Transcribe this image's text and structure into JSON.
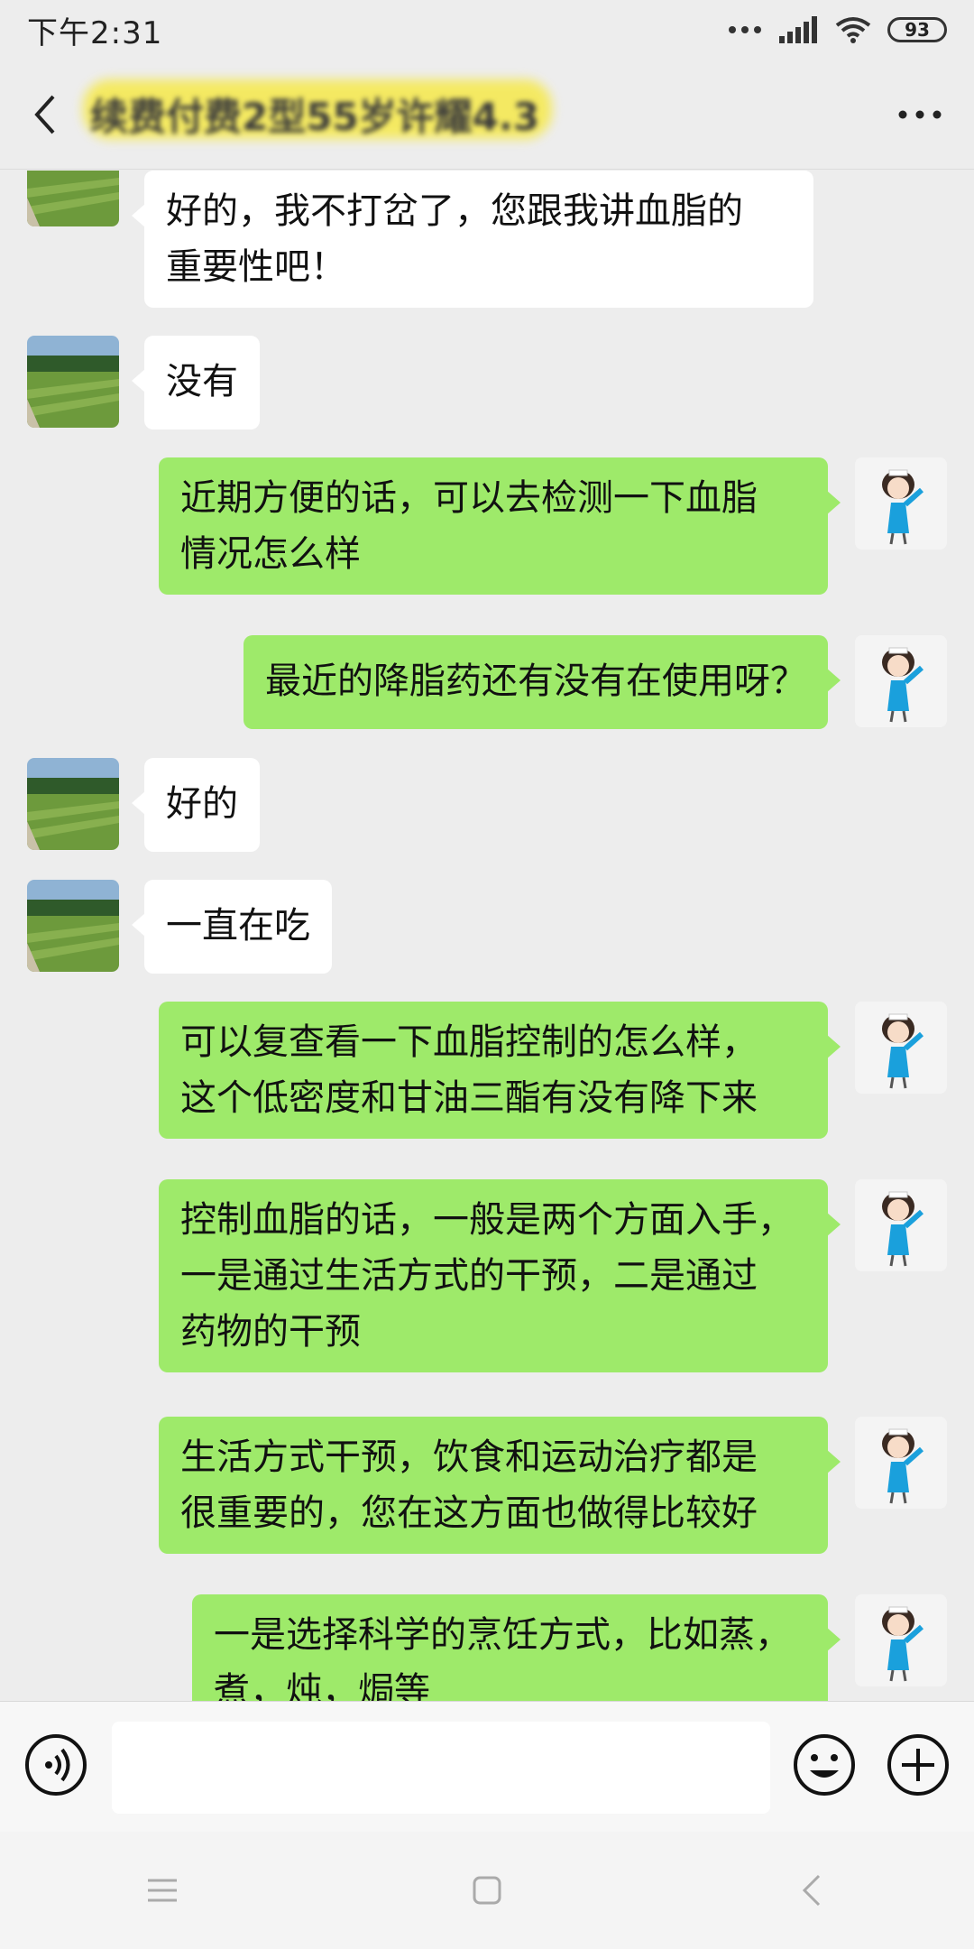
{
  "status_bar": {
    "time": "下午2:31",
    "battery": "93"
  },
  "header": {
    "title": "续费付费2型55岁许耀4.3"
  },
  "messages": [
    {
      "side": "left",
      "text": "好的，我不打岔了，您跟我讲血脂的\n重要性吧！"
    },
    {
      "side": "left",
      "text": "没有"
    },
    {
      "side": "right",
      "text": "近期方便的话，可以去检测一下血脂\n情况怎么样"
    },
    {
      "side": "right",
      "text": "最近的降脂药还有没有在使用呀？"
    },
    {
      "side": "left",
      "text": "好的"
    },
    {
      "side": "left",
      "text": "一直在吃"
    },
    {
      "side": "right",
      "text": "可以复查看一下血脂控制的怎么样，\n这个低密度和甘油三酯有没有降下来"
    },
    {
      "side": "right",
      "text": "控制血脂的话，一般是两个方面入手，\n一是通过生活方式的干预，二是通过\n药物的干预"
    },
    {
      "side": "right",
      "text": "生活方式干预，饮食和运动治疗都是\n很重要的，您在这方面也做得比较好"
    },
    {
      "side": "right",
      "text": "一是选择科学的烹饪方式，比如蒸，\n煮，炖，焗等"
    }
  ],
  "input": {
    "value": "",
    "placeholder": ""
  },
  "colors": {
    "accent_green": "#9eea6a",
    "background": "#ededed"
  }
}
